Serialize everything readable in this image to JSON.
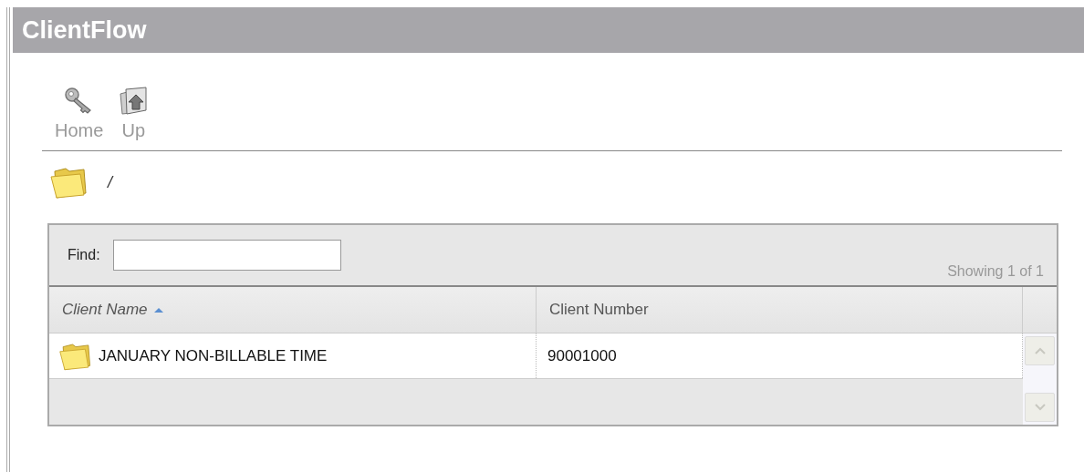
{
  "window": {
    "title": "ClientFlow"
  },
  "toolbar": [
    {
      "label": "Home",
      "kind": "key"
    },
    {
      "label": "Up",
      "kind": "up"
    }
  ],
  "path": "/",
  "grid": {
    "find": {
      "label": "Find:"
    },
    "status": "Showing 1 of 1",
    "columns": [
      {
        "label": "Client Name",
        "sorted": true
      },
      {
        "label": "Client Number",
        "sorted": false
      }
    ],
    "rows": [
      {
        "client_name": "JANUARY NON-BILLABLE TIME",
        "client_number": "90001000",
        "selected": false
      }
    ]
  }
}
